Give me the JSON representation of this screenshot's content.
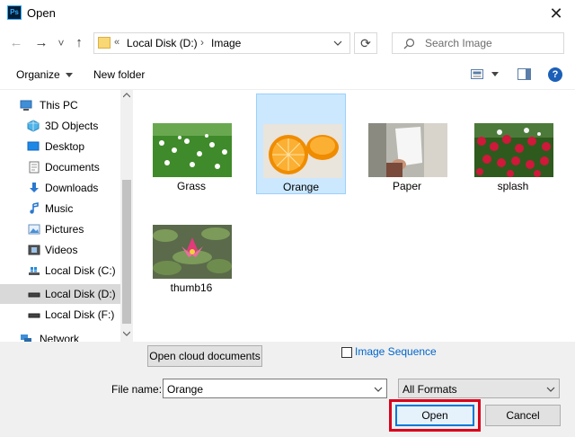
{
  "window": {
    "title": "Open",
    "app_icon_text": "Ps",
    "close_glyph": "✕"
  },
  "nav": {
    "back_glyph": "←",
    "forward_glyph": "→",
    "recent_glyph": "˅",
    "up_glyph": "↑",
    "overflow": "«",
    "path": [
      "Local Disk (D:)",
      "Image"
    ],
    "separator": "›",
    "refresh_glyph": "⟳",
    "search_placeholder": "Search Image"
  },
  "toolbar": {
    "organize_label": "Organize",
    "new_folder_label": "New folder",
    "help_glyph": "?"
  },
  "sidebar": {
    "items": [
      {
        "label": "This PC",
        "icon": "pc-icon"
      },
      {
        "label": "3D Objects",
        "icon": "3d-objects-icon"
      },
      {
        "label": "Desktop",
        "icon": "desktop-icon"
      },
      {
        "label": "Documents",
        "icon": "documents-icon"
      },
      {
        "label": "Downloads",
        "icon": "downloads-icon"
      },
      {
        "label": "Music",
        "icon": "music-icon"
      },
      {
        "label": "Pictures",
        "icon": "pictures-icon"
      },
      {
        "label": "Videos",
        "icon": "videos-icon"
      },
      {
        "label": "Local Disk (C:)",
        "icon": "drive-icon"
      },
      {
        "label": "Local Disk (D:)",
        "icon": "drive-icon",
        "selected": true
      },
      {
        "label": "Local Disk (F:)",
        "icon": "drive-icon"
      },
      {
        "label": "Network",
        "icon": "network-icon"
      }
    ]
  },
  "files": [
    {
      "name": "Grass"
    },
    {
      "name": "Orange",
      "selected": true
    },
    {
      "name": "Paper"
    },
    {
      "name": "splash"
    },
    {
      "name": "thumb16"
    }
  ],
  "bottom": {
    "cloud_button": "Open cloud documents",
    "image_sequence_label": "Image Sequence",
    "file_name_label": "File name:",
    "file_name_value": "Orange",
    "format_value": "All Formats",
    "open_button": "Open",
    "cancel_button": "Cancel"
  },
  "colors": {
    "selection": "#cce8ff",
    "highlight_outline": "#d9001b",
    "link_blue": "#0066cc"
  }
}
